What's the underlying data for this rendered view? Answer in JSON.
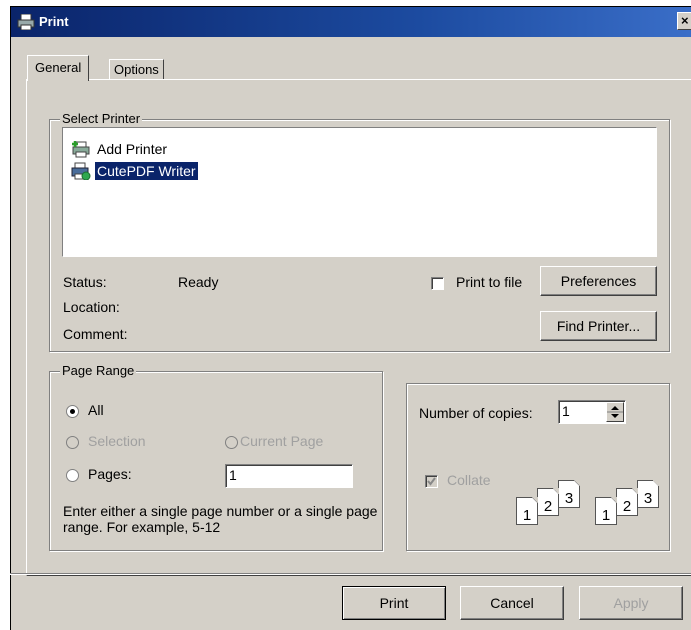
{
  "window": {
    "title": "Print",
    "close_glyph": "×"
  },
  "tabs": [
    {
      "label": "General"
    },
    {
      "label": "Options"
    }
  ],
  "select_printer": {
    "legend": "Select Printer",
    "printers": [
      {
        "label": "Add Printer",
        "icon": "add-printer-icon"
      },
      {
        "label": "CutePDF Writer",
        "icon": "printer-icon",
        "selected": true
      }
    ],
    "status_label": "Status:",
    "status_value": "Ready",
    "location_label": "Location:",
    "location_value": "",
    "comment_label": "Comment:",
    "comment_value": "",
    "print_to_file_label": "Print to file",
    "print_to_file_checked": false,
    "preferences_label": "Preferences",
    "find_printer_label": "Find Printer..."
  },
  "page_range": {
    "legend": "Page Range",
    "all_label": "All",
    "selection_label": "Selection",
    "current_page_label": "Current Page",
    "pages_label": "Pages:",
    "pages_value": "1",
    "hint": "Enter either a single page number or a single page range.  For example, 5-12",
    "selected": "All"
  },
  "copies": {
    "label": "Number of copies:",
    "value": "1",
    "collate_label": "Collate",
    "collate_checked": true,
    "collate_numbers": [
      "1",
      "2",
      "3"
    ]
  },
  "footer": {
    "print_label": "Print",
    "cancel_label": "Cancel",
    "apply_label": "Apply"
  },
  "colors": {
    "title_bar": "#0a246a",
    "dialog_face": "#d4d0c8",
    "selection": "#0a246a"
  }
}
